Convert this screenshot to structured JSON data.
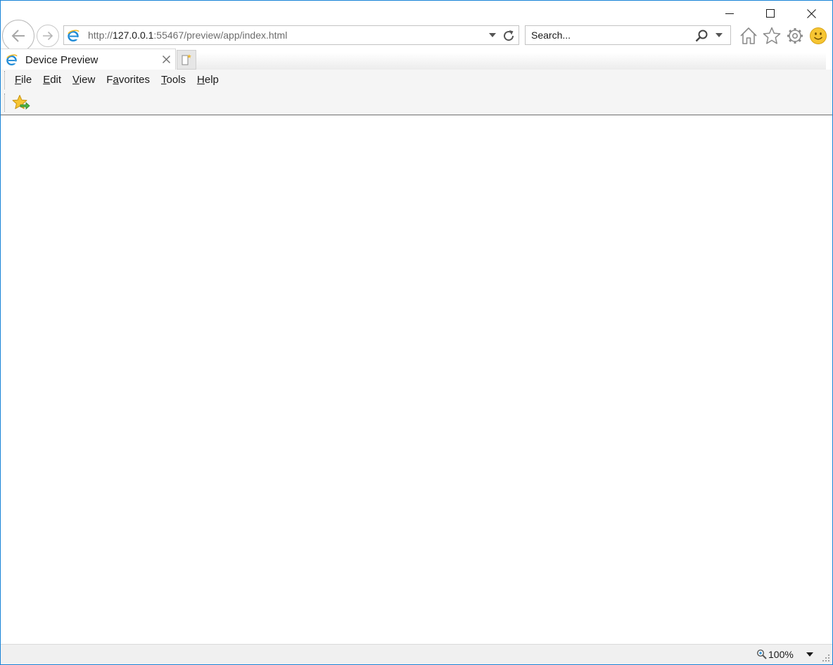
{
  "url": {
    "prefix": "http://",
    "host": "127.0.0.1",
    "rest": ":55467/preview/app/index.html"
  },
  "search": {
    "placeholder": "Search..."
  },
  "tab": {
    "title": "Device Preview"
  },
  "menu": [
    {
      "underline": "F",
      "rest": "ile"
    },
    {
      "underline": "E",
      "rest": "dit"
    },
    {
      "underline": "V",
      "rest": "iew"
    },
    {
      "prefix": "F",
      "underline": "a",
      "rest": "vorites"
    },
    {
      "underline": "T",
      "rest": "ools"
    },
    {
      "underline": "H",
      "rest": "elp"
    }
  ],
  "status": {
    "zoom": "100%"
  },
  "icons": {
    "back": "back-arrow-icon",
    "forward": "forward-arrow-icon",
    "site": "ie-page-icon",
    "refresh": "refresh-icon",
    "search": "magnifier-icon",
    "home": "home-icon",
    "favorites": "star-icon",
    "tools": "gear-icon",
    "feedback": "smiley-icon",
    "add_favorite": "add-to-favorites-bar-icon",
    "zoom": "zoom-icon"
  },
  "colors": {
    "window_border": "#1883d7",
    "ie_blue": "#1e8ad6",
    "smiley": "#f6c533"
  }
}
